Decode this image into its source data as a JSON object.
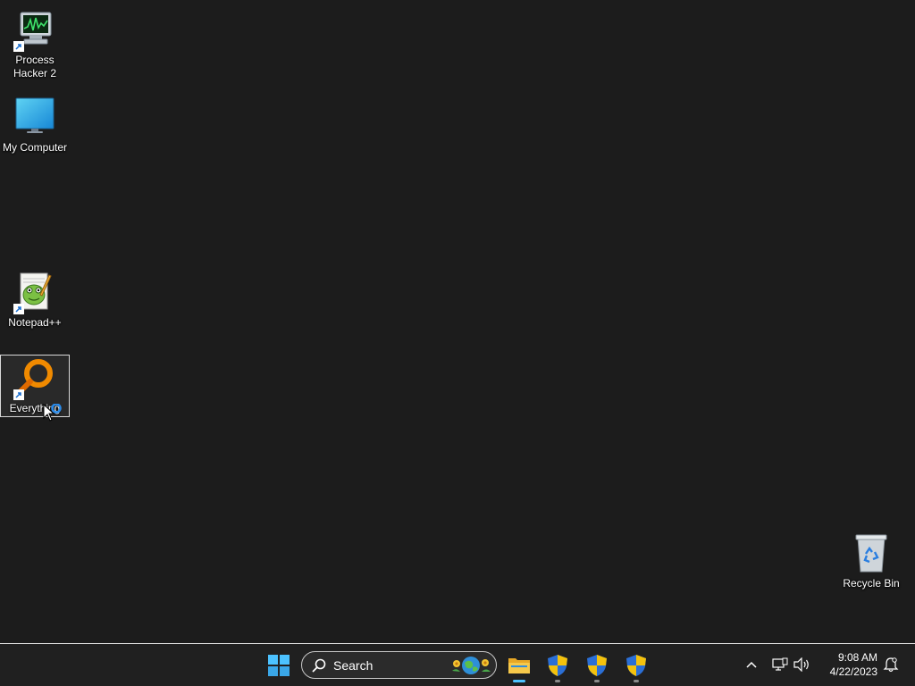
{
  "desktop": {
    "icons": [
      {
        "label": "Process\nHacker 2",
        "icon": "process-hacker-icon"
      },
      {
        "label": "My Computer",
        "icon": "monitor-icon"
      },
      {
        "label": "Notepad++",
        "icon": "notepad-plus-plus-icon"
      },
      {
        "label": "Everything",
        "icon": "everything-search-icon"
      },
      {
        "label": "Recycle Bin",
        "icon": "recycle-bin-icon"
      }
    ]
  },
  "taskbar": {
    "start_icon": "windows-start-icon",
    "search": {
      "placeholder": "Search"
    },
    "pinned": [
      {
        "name": "File Explorer",
        "icon": "folder-icon",
        "active": true
      },
      {
        "name": "Shield app 1",
        "icon": "uac-shield-icon",
        "active": false
      },
      {
        "name": "Shield app 2",
        "icon": "uac-shield-icon",
        "active": false
      },
      {
        "name": "Shield app 3",
        "icon": "uac-shield-icon",
        "active": false
      }
    ],
    "tray": {
      "overflow_icon": "chevron-up-icon",
      "network_icon": "network-icon",
      "volume_icon": "speaker-icon",
      "notification_icon": "notification-bell-icon"
    },
    "clock": {
      "time": "9:08 AM",
      "date": "4/22/2023"
    }
  },
  "colors": {
    "desktop_bg": "#1c1c1c",
    "taskbar_bg": "#202020",
    "accent": "#4cc2ff"
  }
}
